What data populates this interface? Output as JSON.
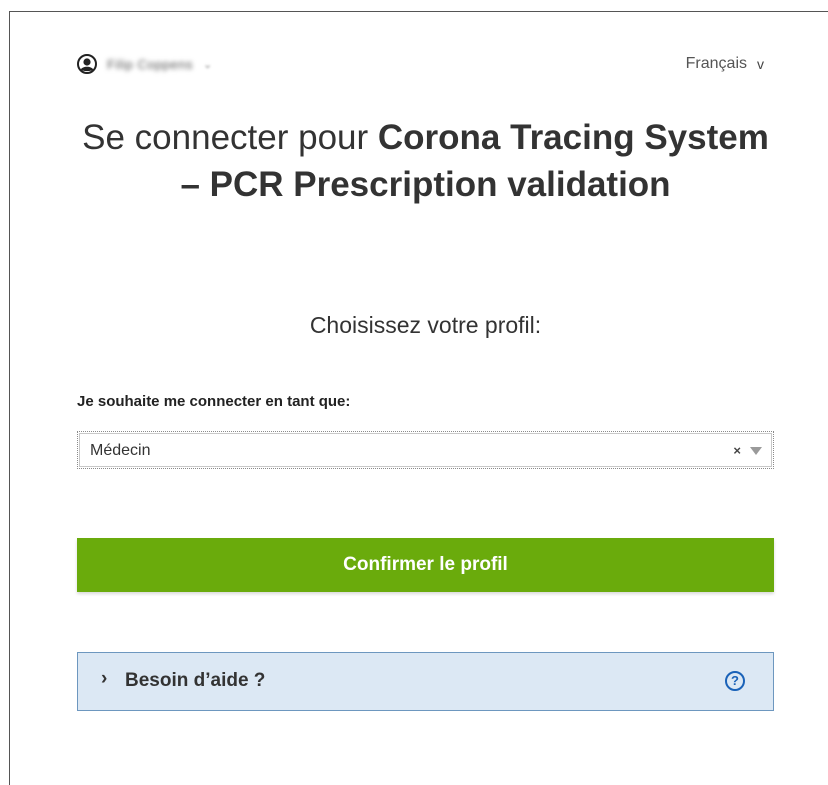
{
  "user": {
    "name": "Filip Coppens",
    "icon": "user-circle-icon"
  },
  "language": {
    "label": "Français",
    "caret": "v"
  },
  "title": {
    "prefix": "Se connecter pour ",
    "app_name": "Corona Tracing System – PCR Prescription validation"
  },
  "profile": {
    "heading": "Choisissez votre profil:",
    "field_label": "Je souhaite me connecter en tant que:",
    "selected": "Médecin",
    "clear": "×"
  },
  "confirm_label": "Confirmer le profil",
  "help": {
    "chevron": "›",
    "label": "Besoin d’aide ?",
    "icon_glyph": "?"
  },
  "colors": {
    "confirm_bg": "#6aab0c",
    "help_bg": "#dce8f4",
    "help_border": "#6d97bf",
    "help_icon": "#1a62b8"
  }
}
